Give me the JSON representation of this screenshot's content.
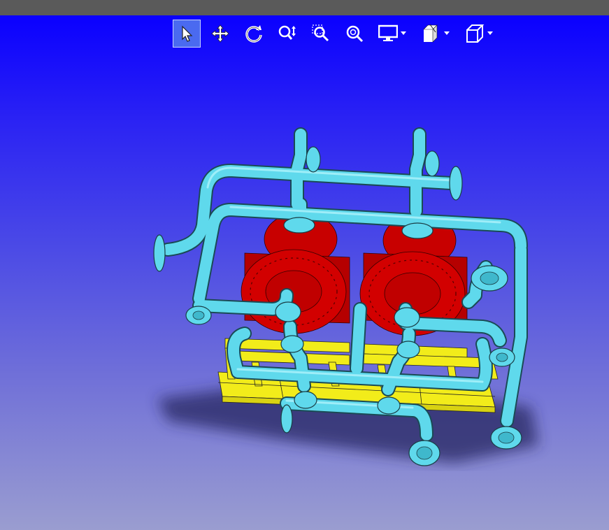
{
  "window": {
    "title_bar": ""
  },
  "toolbar": {
    "items": [
      {
        "name": "select",
        "icon": "select-arrow-icon",
        "active": true
      },
      {
        "name": "pan",
        "icon": "pan-move-icon",
        "active": false
      },
      {
        "name": "rotate",
        "icon": "rotate-icon",
        "active": false
      },
      {
        "name": "zoom",
        "icon": "zoom-updown-icon",
        "active": false
      },
      {
        "name": "zoom-window",
        "icon": "zoom-window-icon",
        "active": false
      },
      {
        "name": "zoom-fit",
        "icon": "zoom-fit-icon",
        "active": false
      },
      {
        "name": "display-mode",
        "icon": "monitor-icon",
        "has_dropdown": true
      },
      {
        "name": "sectioning",
        "icon": "section-cube-icon",
        "has_dropdown": true
      },
      {
        "name": "standard-views",
        "icon": "iso-cube-icon",
        "has_dropdown": true
      }
    ]
  },
  "colors": {
    "viewport_top": "#0a00ff",
    "viewport_bottom": "#9a9dd0",
    "pipe": "#5fd9ec",
    "pump_body": "#d00000",
    "skid_frame": "#f2ec1a",
    "shadow": "#2a2a55"
  },
  "model": {
    "description_visible": false,
    "components": [
      "pipes",
      "pumps",
      "skid"
    ]
  }
}
